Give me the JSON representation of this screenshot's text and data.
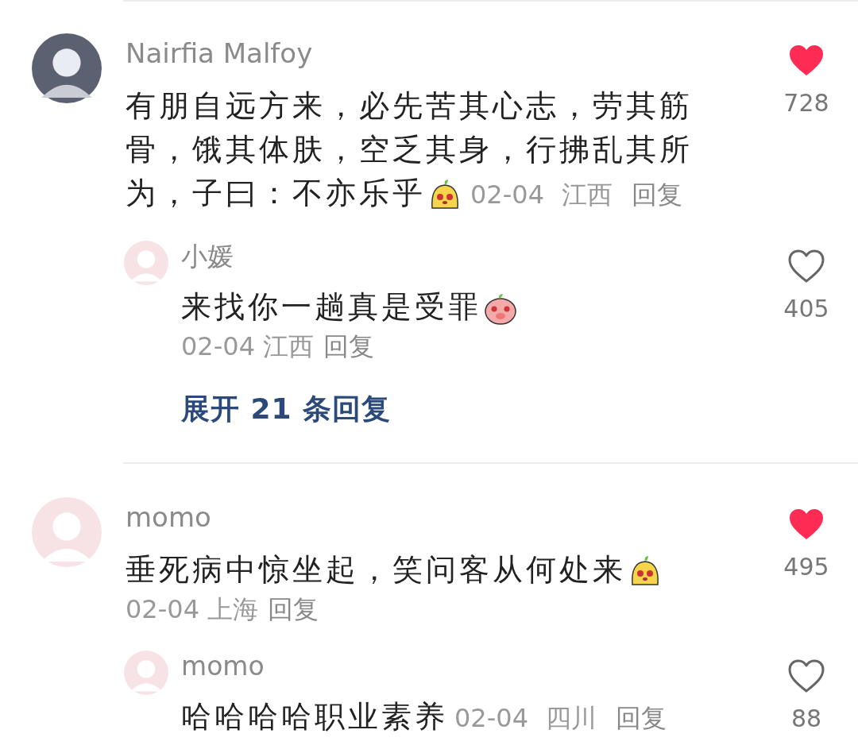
{
  "comments": [
    {
      "author": "Nairfia Malfoy",
      "avatar": {
        "kind": "dark"
      },
      "text": "有朋自远方来，必先苦其心志，劳其筋骨，饿其体肤，空乏其身，行拂乱其所为，子曰：不亦乐乎",
      "sticker": {
        "kind": "blob"
      },
      "meta_inline": true,
      "date": "02-04",
      "location": "江西",
      "reply": "回复",
      "liked": true,
      "likes": "728",
      "replies": [
        {
          "author": "小媛",
          "avatar": {
            "kind": "light"
          },
          "text": "来找你一趟真是受罪",
          "sticker": {
            "kind": "pig"
          },
          "meta_inline": false,
          "date": "02-04",
          "location": "江西",
          "reply": "回复",
          "liked": false,
          "likes": "405"
        }
      ],
      "expand": "展开 21 条回复"
    },
    {
      "author": "momo",
      "avatar": {
        "kind": "light"
      },
      "text": "垂死病中惊坐起，笑问客从何处来",
      "sticker": {
        "kind": "blob"
      },
      "meta_inline": false,
      "date": "02-04",
      "location": "上海",
      "reply": "回复",
      "liked": true,
      "likes": "495",
      "replies": [
        {
          "author": "momo",
          "avatar": {
            "kind": "light"
          },
          "text": "哈哈哈哈职业素养",
          "meta_inline": true,
          "date": "02-04",
          "location": "四川",
          "reply": "回复",
          "liked": false,
          "likes": "88"
        }
      ]
    }
  ]
}
